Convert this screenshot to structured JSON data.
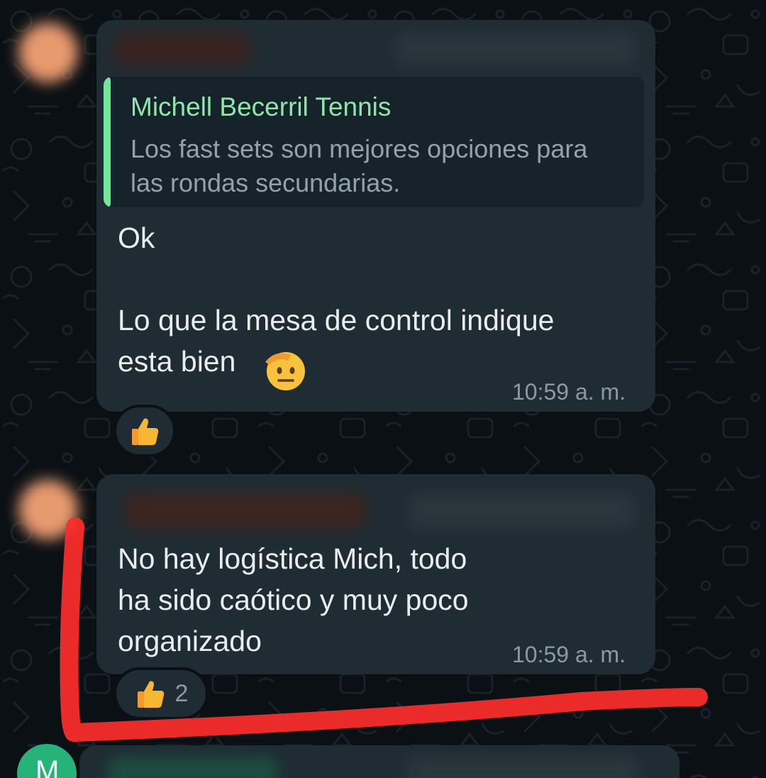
{
  "message1": {
    "quote_author": "Michell Becerril Tennis",
    "quote_text": "Los fast sets son mejores opciones para las rondas secundarias.",
    "text": "Ok\n\nLo que la mesa de control indique\nesta bien",
    "emoji": "saluting-face-icon",
    "time": "10:59 a. m.",
    "reaction": {
      "emoji": "thumbs-up-icon",
      "count": ""
    }
  },
  "message2": {
    "text": "No hay logística Mich, todo\nha sido caótico y muy poco\norganizado",
    "time": "10:59 a. m.",
    "reaction": {
      "emoji": "thumbs-up-icon",
      "count": "2"
    }
  },
  "message3": {
    "avatar_initial": "M"
  },
  "colors": {
    "background": "#0b1014",
    "bubble": "#1f2c33",
    "quote_accent": "#71e79a",
    "annotation": "#ff2d2d",
    "avatar_green": "#25b37a"
  }
}
